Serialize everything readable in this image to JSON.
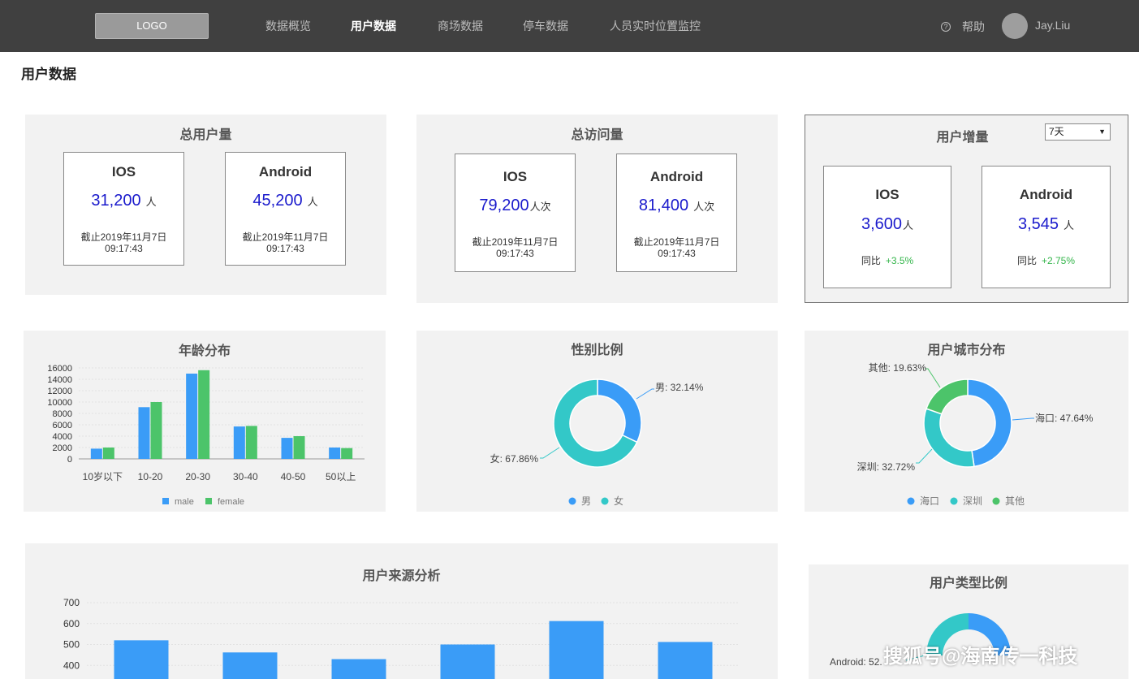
{
  "header": {
    "logo": "LOGO",
    "nav": [
      "数据概览",
      "用户数据",
      "商场数据",
      "停车数据",
      "人员实时位置监控"
    ],
    "active_index": 1,
    "help_icon": "?",
    "help": "帮助",
    "user": "Jay.Liu"
  },
  "page_title": "用户数据",
  "total_users": {
    "title": "总用户量",
    "cards": [
      {
        "title": "IOS",
        "value": "31,200",
        "unit": "人",
        "note1": "截止2019年11月7日",
        "note2": "09:17:43"
      },
      {
        "title": "Android",
        "value": "45,200",
        "unit": "人",
        "note1": "截止2019年11月7日",
        "note2": "09:17:43"
      }
    ]
  },
  "total_visits": {
    "title": "总访问量",
    "cards": [
      {
        "title": "IOS",
        "value": "79,200",
        "unit": "人次",
        "note1": "截止2019年11月7日",
        "note2": "09:17:43"
      },
      {
        "title": "Android",
        "value": "81,400",
        "unit": "人次",
        "note1": "截止2019年11月7日",
        "note2": "09:17:43"
      }
    ]
  },
  "user_growth": {
    "title": "用户增量",
    "select_value": "7天",
    "cards": [
      {
        "title": "IOS",
        "value": "3,600",
        "unit": "人",
        "note_label": "同比",
        "note_value": "+3.5%"
      },
      {
        "title": "Android",
        "value": "3,545",
        "unit": "人",
        "note_label": "同比",
        "note_value": "+2.75%"
      }
    ]
  },
  "colors": {
    "blue": "#3a9cf7",
    "green": "#4cc46a",
    "teal": "#33c8c8"
  },
  "chart_data": [
    {
      "type": "bar",
      "title": "年龄分布",
      "categories": [
        "10岁以下",
        "10-20",
        "20-30",
        "30-40",
        "40-50",
        "50以上"
      ],
      "series": [
        {
          "name": "male",
          "values": [
            1800,
            9100,
            15000,
            5700,
            3700,
            2000
          ]
        },
        {
          "name": "female",
          "values": [
            2000,
            10000,
            15600,
            5800,
            4000,
            1900
          ]
        }
      ],
      "yticks": [
        "0",
        "2000",
        "4000",
        "6000",
        "8000",
        "10000",
        "12000",
        "14000",
        "16000"
      ],
      "ylim": [
        0,
        16000
      ],
      "legend": "bottom"
    },
    {
      "type": "pie",
      "title": "性别比例",
      "donut": true,
      "slices": [
        {
          "name": "男",
          "value": 32.14,
          "label": "男: 32.14%"
        },
        {
          "name": "女",
          "value": 67.86,
          "label": "女: 67.86%"
        }
      ],
      "legend": "bottom"
    },
    {
      "type": "pie",
      "title": "用户城市分布",
      "donut": true,
      "slices": [
        {
          "name": "海口",
          "value": 47.64,
          "label": "海口: 47.64%"
        },
        {
          "name": "深圳",
          "value": 32.72,
          "label": "深圳: 32.72%"
        },
        {
          "name": "其他",
          "value": 19.63,
          "label": "其他: 19.63%"
        }
      ],
      "legend": "bottom"
    },
    {
      "type": "bar",
      "title": "用户来源分析",
      "values": [
        520,
        462,
        430,
        500,
        612,
        512
      ],
      "yticks": [
        "400",
        "500",
        "600",
        "700"
      ],
      "ylim": [
        0,
        700
      ]
    },
    {
      "type": "pie",
      "title": "用户类型比例",
      "donut": true,
      "visible_label": "Android: 52."
    }
  ],
  "watermark": "搜狐号@海南传一科技"
}
